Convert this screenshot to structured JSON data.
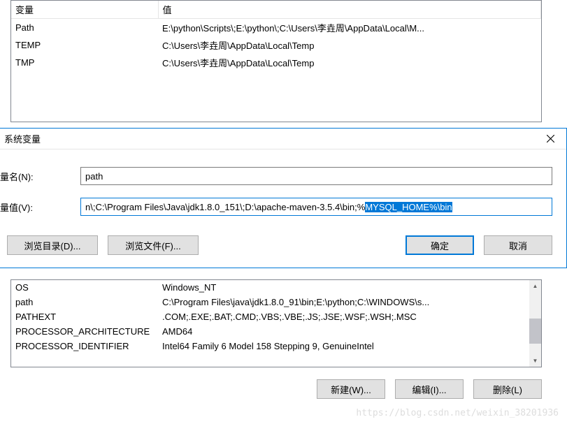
{
  "userVarsTable": {
    "headers": {
      "variable": "变量",
      "value": "值"
    },
    "rows": [
      {
        "var": "Path",
        "val": "E:\\python\\Scripts\\;E:\\python\\;C:\\Users\\李垚周\\AppData\\Local\\M..."
      },
      {
        "var": "TEMP",
        "val": "C:\\Users\\李垚周\\AppData\\Local\\Temp"
      },
      {
        "var": "TMP",
        "val": "C:\\Users\\李垚周\\AppData\\Local\\Temp"
      }
    ]
  },
  "dialog": {
    "title": "系统变量",
    "nameLabel": "量名(N):",
    "nameValue": "path",
    "valueLabel": "量值(V):",
    "valuePrefix": "n\\;C:\\Program Files\\Java\\jdk1.8.0_151\\;D:\\apache-maven-3.5.4\\bin;%",
    "valueSelected": "MYSQL_HOME%\\bin",
    "browseDir": "浏览目录(D)...",
    "browseFile": "浏览文件(F)...",
    "ok": "确定",
    "cancel": "取消"
  },
  "sysVarsTable": {
    "rows": [
      {
        "var": "OS",
        "val": "Windows_NT"
      },
      {
        "var": "path",
        "val": "C:\\Program Files\\java\\jdk1.8.0_91\\bin;E:\\python;C:\\WINDOWS\\s..."
      },
      {
        "var": "PATHEXT",
        "val": ".COM;.EXE;.BAT;.CMD;.VBS;.VBE;.JS;.JSE;.WSF;.WSH;.MSC"
      },
      {
        "var": "PROCESSOR_ARCHITECTURE",
        "val": "AMD64"
      },
      {
        "var": "PROCESSOR_IDENTIFIER",
        "val": "Intel64 Family 6 Model 158 Stepping 9, GenuineIntel"
      }
    ]
  },
  "bottomButtons": {
    "new": "新建(W)...",
    "edit": "编辑(I)...",
    "delete": "删除(L)"
  },
  "watermark": "https://blog.csdn.net/weixin_38201936"
}
